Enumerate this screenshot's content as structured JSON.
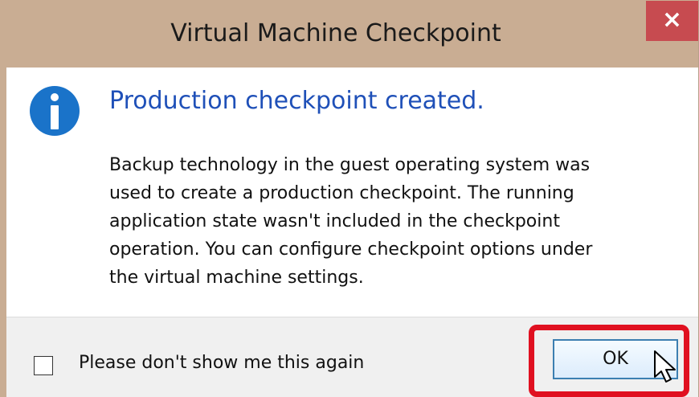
{
  "dialog": {
    "title": "Virtual Machine Checkpoint",
    "close_label": "×",
    "icon": "info-icon",
    "headline": "Production checkpoint created.",
    "message_lines": [
      "Backup technology in the guest operating system was",
      "used to create a production checkpoint. The running",
      "application state wasn't included in the checkpoint",
      "operation. You can configure checkpoint options under",
      "the virtual machine settings."
    ],
    "checkbox": {
      "label": "Please don't show me this again",
      "checked": false
    },
    "ok_label": "OK"
  },
  "colors": {
    "titlebar": "#c9ad93",
    "close_button": "#c74b50",
    "headline": "#1f50b8",
    "info_icon": "#1a73c9",
    "highlight_box": "#e01020",
    "button_border": "#3c7fb1"
  },
  "annotation": {
    "highlight": "ok-button",
    "cursor": "arrow-cursor-icon"
  }
}
